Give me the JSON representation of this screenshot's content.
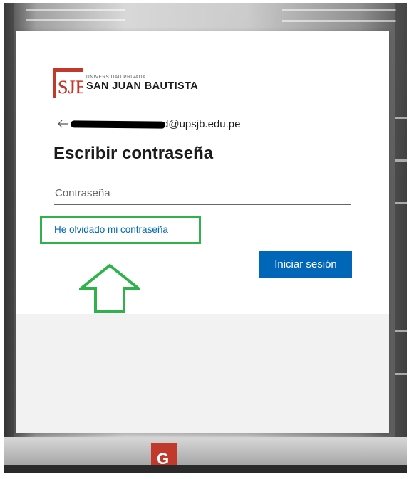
{
  "logo": {
    "mark_text": "SJB",
    "small_text": "UNIVERSIDAD PRIVADA",
    "big_text": "SAN JUAN BAUTISTA",
    "brand_color": "#c0392b"
  },
  "identity": {
    "back_icon": "arrow-left-icon",
    "email_visible": "d@upsjb.edu.pe"
  },
  "form": {
    "title": "Escribir contraseña",
    "password_placeholder": "Contraseña",
    "password_value": "",
    "forgot_link": "He olvidado mi contraseña",
    "signin_button": "Iniciar sesión"
  },
  "annotation": {
    "highlight_color": "#2db34a",
    "arrow_icon": "up-arrow-outline-icon"
  },
  "colors": {
    "accent": "#0067b8",
    "footer_bg": "#f2f2f2"
  },
  "background": {
    "sign_text": "G"
  }
}
